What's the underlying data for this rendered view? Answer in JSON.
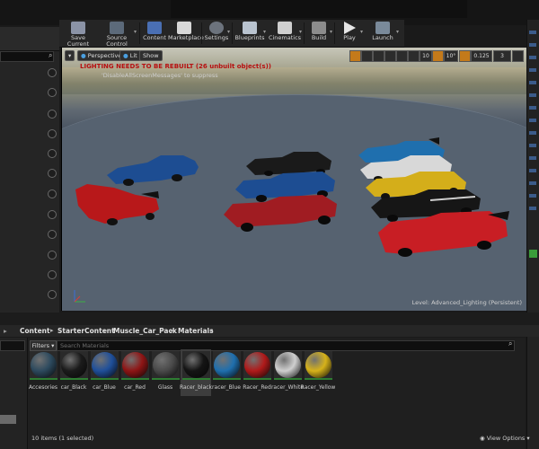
{
  "toolbar": {
    "buttons": [
      {
        "label": "Save Current",
        "icon": "save-icon"
      },
      {
        "label": "Source Control",
        "icon": "source-control-icon"
      },
      {
        "label": "Content",
        "icon": "content-icon"
      },
      {
        "label": "Marketplace",
        "icon": "marketplace-icon"
      },
      {
        "label": "Settings",
        "icon": "settings-icon"
      },
      {
        "label": "Blueprints",
        "icon": "blueprints-icon"
      },
      {
        "label": "Cinematics",
        "icon": "cinematics-icon"
      },
      {
        "label": "Build",
        "icon": "build-icon"
      },
      {
        "label": "Play",
        "icon": "play-icon"
      },
      {
        "label": "Launch",
        "icon": "launch-icon"
      }
    ]
  },
  "viewport": {
    "perspective_label": "Perspective",
    "lit_label": "Lit",
    "show_label": "Show",
    "warning": "LIGHTING NEEDS TO BE REBUILT (26 unbuilt object(s))",
    "warning_hint": "'DisableAllScreenMessages' to suppress",
    "grid_snap": "10",
    "rotate_snap": "10°",
    "scale_snap": "0.125",
    "camera_speed": "3",
    "level_label": "Level:  Advanced_Lighting (Persistent)"
  },
  "content_browser": {
    "breadcrumb": [
      "Content",
      "StarterContent",
      "Muscle_Car_Pack",
      "Materials"
    ],
    "filters_label": "Filters",
    "search_placeholder": "Search Materials",
    "assets": [
      {
        "name": "Accesories",
        "color": "#2d4a5e"
      },
      {
        "name": "car_Black",
        "color": "#1b1b1b"
      },
      {
        "name": "car_Blue",
        "color": "#1f4f9a"
      },
      {
        "name": "car_Red",
        "color": "#8e1515"
      },
      {
        "name": "Glass",
        "color": "#4a4a4a"
      },
      {
        "name": "Racer_black",
        "color": "#141414"
      },
      {
        "name": "racer_Blue",
        "color": "#1f6fae"
      },
      {
        "name": "Racer_Red",
        "color": "#b01a1a"
      },
      {
        "name": "racer_White",
        "color": "#cfcfcf"
      },
      {
        "name": "Racer_Yellow",
        "color": "#d6b21a"
      }
    ],
    "selected_asset": "Racer_black",
    "status": "10 items (1 selected)",
    "view_options": "View Options"
  }
}
